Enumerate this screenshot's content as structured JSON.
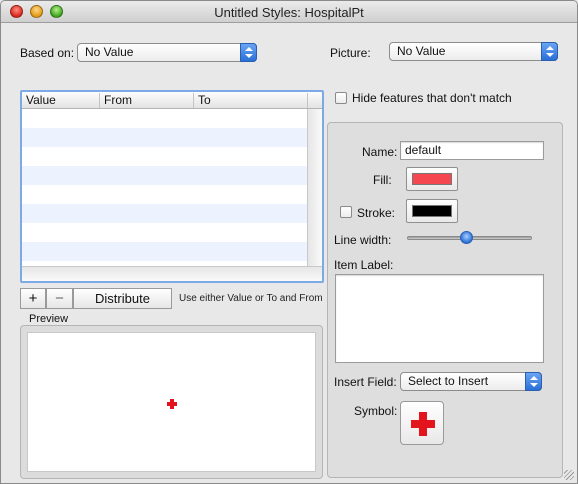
{
  "window": {
    "title": "Untitled Styles: HospitalPt"
  },
  "based_on": {
    "label": "Based on:",
    "value": "No Value"
  },
  "picture": {
    "label": "Picture:",
    "value": "No Value"
  },
  "hide_features": {
    "label": "Hide features that don't match",
    "checked": false
  },
  "table": {
    "columns": [
      "Value",
      "From",
      "To"
    ],
    "rows": []
  },
  "buttons": {
    "add": "+",
    "remove": "−",
    "distribute": "Distribute"
  },
  "hint": "Use either Value or To and From",
  "preview": {
    "label": "Preview"
  },
  "style": {
    "name_label": "Name:",
    "name_value": "default",
    "fill_label": "Fill:",
    "fill_color": "#f4474f",
    "stroke_label": "Stroke:",
    "stroke_checked": false,
    "stroke_color": "#000000",
    "line_width_label": "Line width:",
    "line_width_level": 0.45,
    "item_label_label": "Item Label:",
    "item_label_value": "",
    "insert_field_label": "Insert Field:",
    "insert_field_value": "Select to Insert",
    "symbol_label": "Symbol:",
    "symbol_icon": "red-cross-icon",
    "symbol_color": "#e4141c"
  }
}
